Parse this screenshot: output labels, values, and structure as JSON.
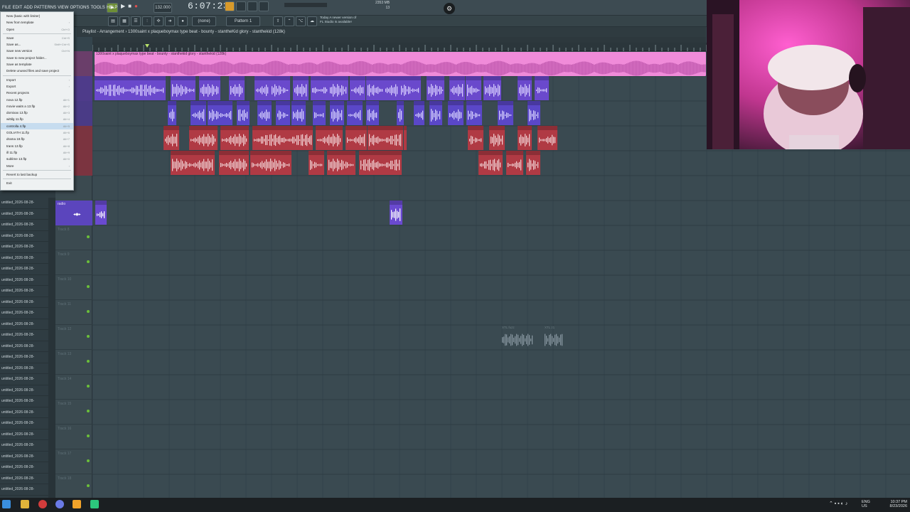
{
  "menu": {
    "items": [
      "FILE",
      "EDIT",
      "ADD",
      "PATTERNS",
      "VIEW",
      "OPTIONS",
      "TOOLS",
      "HELP"
    ]
  },
  "transport": {
    "clock": "6:07:23",
    "pattern": "Pattern 1",
    "tempo": "132.000",
    "none_label": "(none)"
  },
  "notification": {
    "line1": "Today  A newer version of",
    "line2": "FL Studio is available!"
  },
  "cpu": {
    "mem": "2353 MB",
    "value": "13",
    "zero": "0"
  },
  "playlist": {
    "title": "Playlist - Arrangement  ›  1300saint x plaqueboymax type beat - bounty - stantheKid glory - stanthekid (128k)"
  },
  "file_menu": {
    "items": [
      {
        "label": "New (basic with limiter)",
        "shortcut": ""
      },
      {
        "label": "New from template",
        "shortcut": "›"
      },
      {
        "label": "Open",
        "shortcut": "Ctrl+O"
      },
      {
        "sep": true
      },
      {
        "label": "Save",
        "shortcut": "Ctrl+S"
      },
      {
        "label": "Save as...",
        "shortcut": "Shift+Ctrl+S"
      },
      {
        "label": "Save new version",
        "shortcut": "Ctrl+N"
      },
      {
        "label": "Save to new project folder...",
        "shortcut": ""
      },
      {
        "label": "Save as template",
        "shortcut": ""
      },
      {
        "label": "Delete unused files and save project",
        "shortcut": ""
      },
      {
        "sep": true
      },
      {
        "label": "Import",
        "shortcut": "›"
      },
      {
        "label": "Export",
        "shortcut": "›"
      },
      {
        "label": "Recent projects",
        "shortcut": ""
      },
      {
        "label": "nova 12.flp",
        "shortcut": "Alt+1"
      },
      {
        "label": "movie waits a 13.flp",
        "shortcut": "Alt+2"
      },
      {
        "label": "domixax 13.flp",
        "shortcut": "Alt+3"
      },
      {
        "label": "wittilg 11.flp",
        "shortcut": "Alt+4"
      },
      {
        "label": "controlla 4.flp",
        "shortcut": "Alt+5",
        "hl": true
      },
      {
        "label": "GOLIATH 11.flp",
        "shortcut": "Alt+6"
      },
      {
        "label": "drama 18.flp",
        "shortcut": "Alt+7"
      },
      {
        "label": "trans 13.flp",
        "shortcut": "Alt+8"
      },
      {
        "label": "ill 11.flp",
        "shortcut": "Alt+9"
      },
      {
        "label": "sublime 13.flp",
        "shortcut": "Alt+0"
      },
      {
        "label": "More",
        "shortcut": "›"
      },
      {
        "sep": true
      },
      {
        "label": "Revert to last backup",
        "shortcut": ""
      },
      {
        "sep": true
      },
      {
        "label": "Exit",
        "shortcut": ""
      }
    ]
  },
  "browser": {
    "item_label": "untitled_2026-08-28-"
  },
  "tracks": {
    "radio_label": "radio",
    "track_labels": [
      "Track 8",
      "Track 9",
      "Track 10",
      "Track 11",
      "Track 12",
      "Track 13",
      "Track 14",
      "Track 15",
      "Track 16",
      "Track 17",
      "Track 18"
    ]
  },
  "clips": {
    "top_label": "1300saint x plaqueboymax type beat - bounty - stanthekid glory - stanthekid (128k)",
    "faint1": "XTL fuzz",
    "faint2": "XTL z1",
    "label_2kb": "2.3kB",
    "label_2k8": "2.7kB"
  },
  "taskbar": {
    "lang1": "ENG",
    "lang2": "US",
    "time": "10:37 PM",
    "date": "8/23/2026"
  },
  "colors": {
    "playlist_bg": "#3a4a51",
    "pink_clip": "#f08bd9",
    "purple_clip": "#6f4bd2",
    "red_clip": "#b33b43"
  }
}
